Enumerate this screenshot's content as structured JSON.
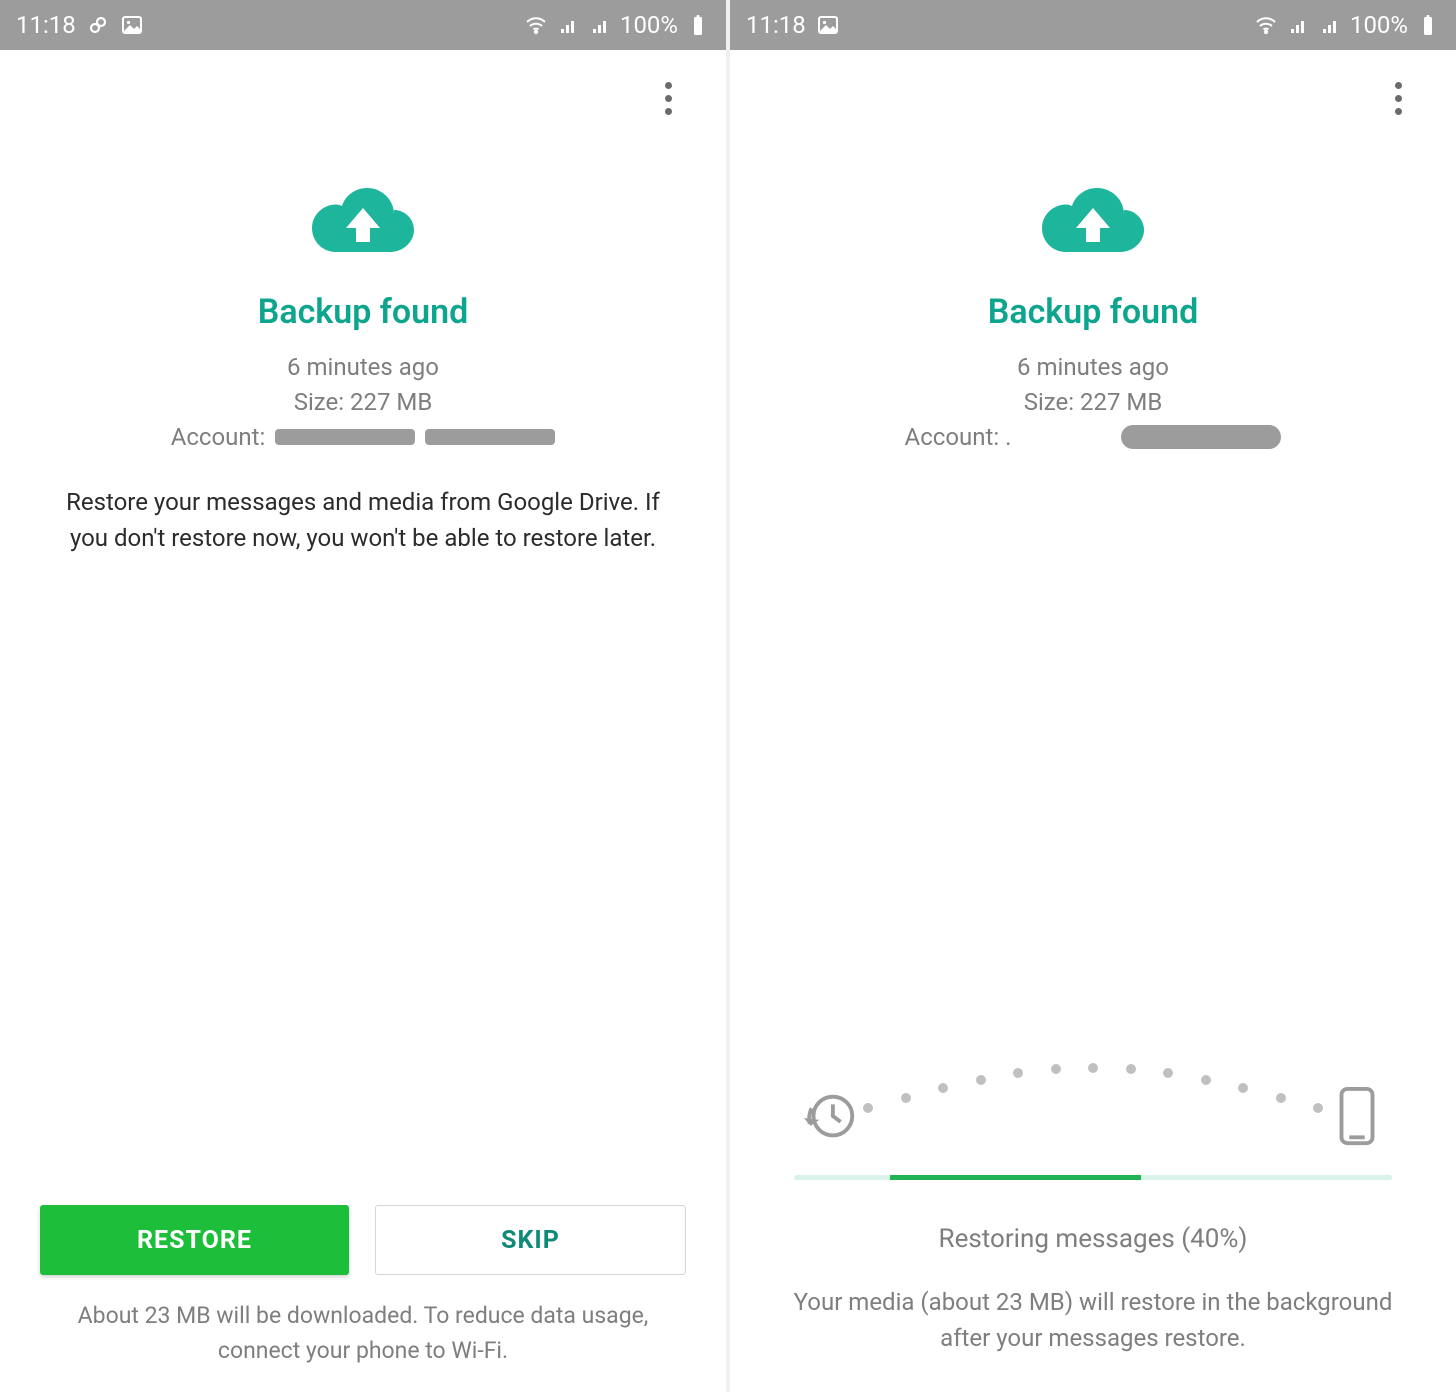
{
  "colors": {
    "accent": "#0ea58f",
    "btnPrimary": "#1dbf3a"
  },
  "left": {
    "status": {
      "time": "11:18",
      "battery": "100%"
    },
    "title": "Backup found",
    "time_ago": "6 minutes ago",
    "size": "Size: 227 MB",
    "account_label": "Account: ",
    "desc": "Restore your messages and media from Google Drive. If you don't restore now, you won't be able to restore later.",
    "btn_restore": "RESTORE",
    "btn_skip": "SKIP",
    "footer": "About 23 MB will be downloaded. To reduce data usage, connect your phone to Wi-Fi."
  },
  "right": {
    "status": {
      "time": "11:18",
      "battery": "100%"
    },
    "title": "Backup found",
    "time_ago": "6 minutes ago",
    "size": "Size: 227 MB",
    "account_label": "Account: .",
    "restoring": "Restoring messages (40%)",
    "progress_percent": 40,
    "note": "Your media (about 23 MB) will restore in the background after your messages restore."
  }
}
